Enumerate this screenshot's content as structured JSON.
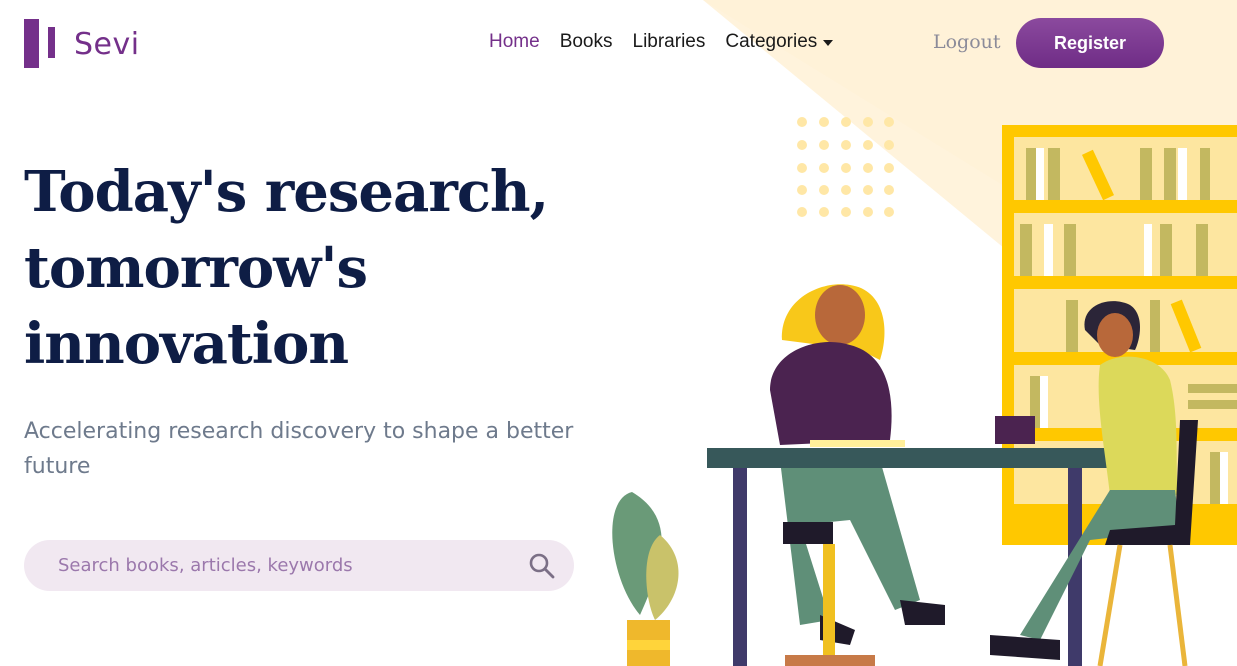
{
  "brand": {
    "name": "Sevi",
    "color": "#74308a"
  },
  "nav": {
    "items": [
      {
        "label": "Home",
        "active": true
      },
      {
        "label": "Books",
        "active": false
      },
      {
        "label": "Libraries",
        "active": false
      },
      {
        "label": "Categories",
        "active": false,
        "dropdown": true
      }
    ]
  },
  "auth": {
    "logout_label": "Logout",
    "register_label": "Register"
  },
  "hero": {
    "title": "Today's research, tomorrow's innovation",
    "subtitle": "Accelerating research discovery to shape a better future"
  },
  "search": {
    "placeholder": "Search books, articles, keywords",
    "value": "",
    "icon": "search-icon"
  },
  "colors": {
    "accent": "#74308a",
    "heading": "#0e1d45",
    "muted": "#6e7a8c",
    "search_bg": "#f1e8f1",
    "illustration_yellow": "#ffc800"
  }
}
